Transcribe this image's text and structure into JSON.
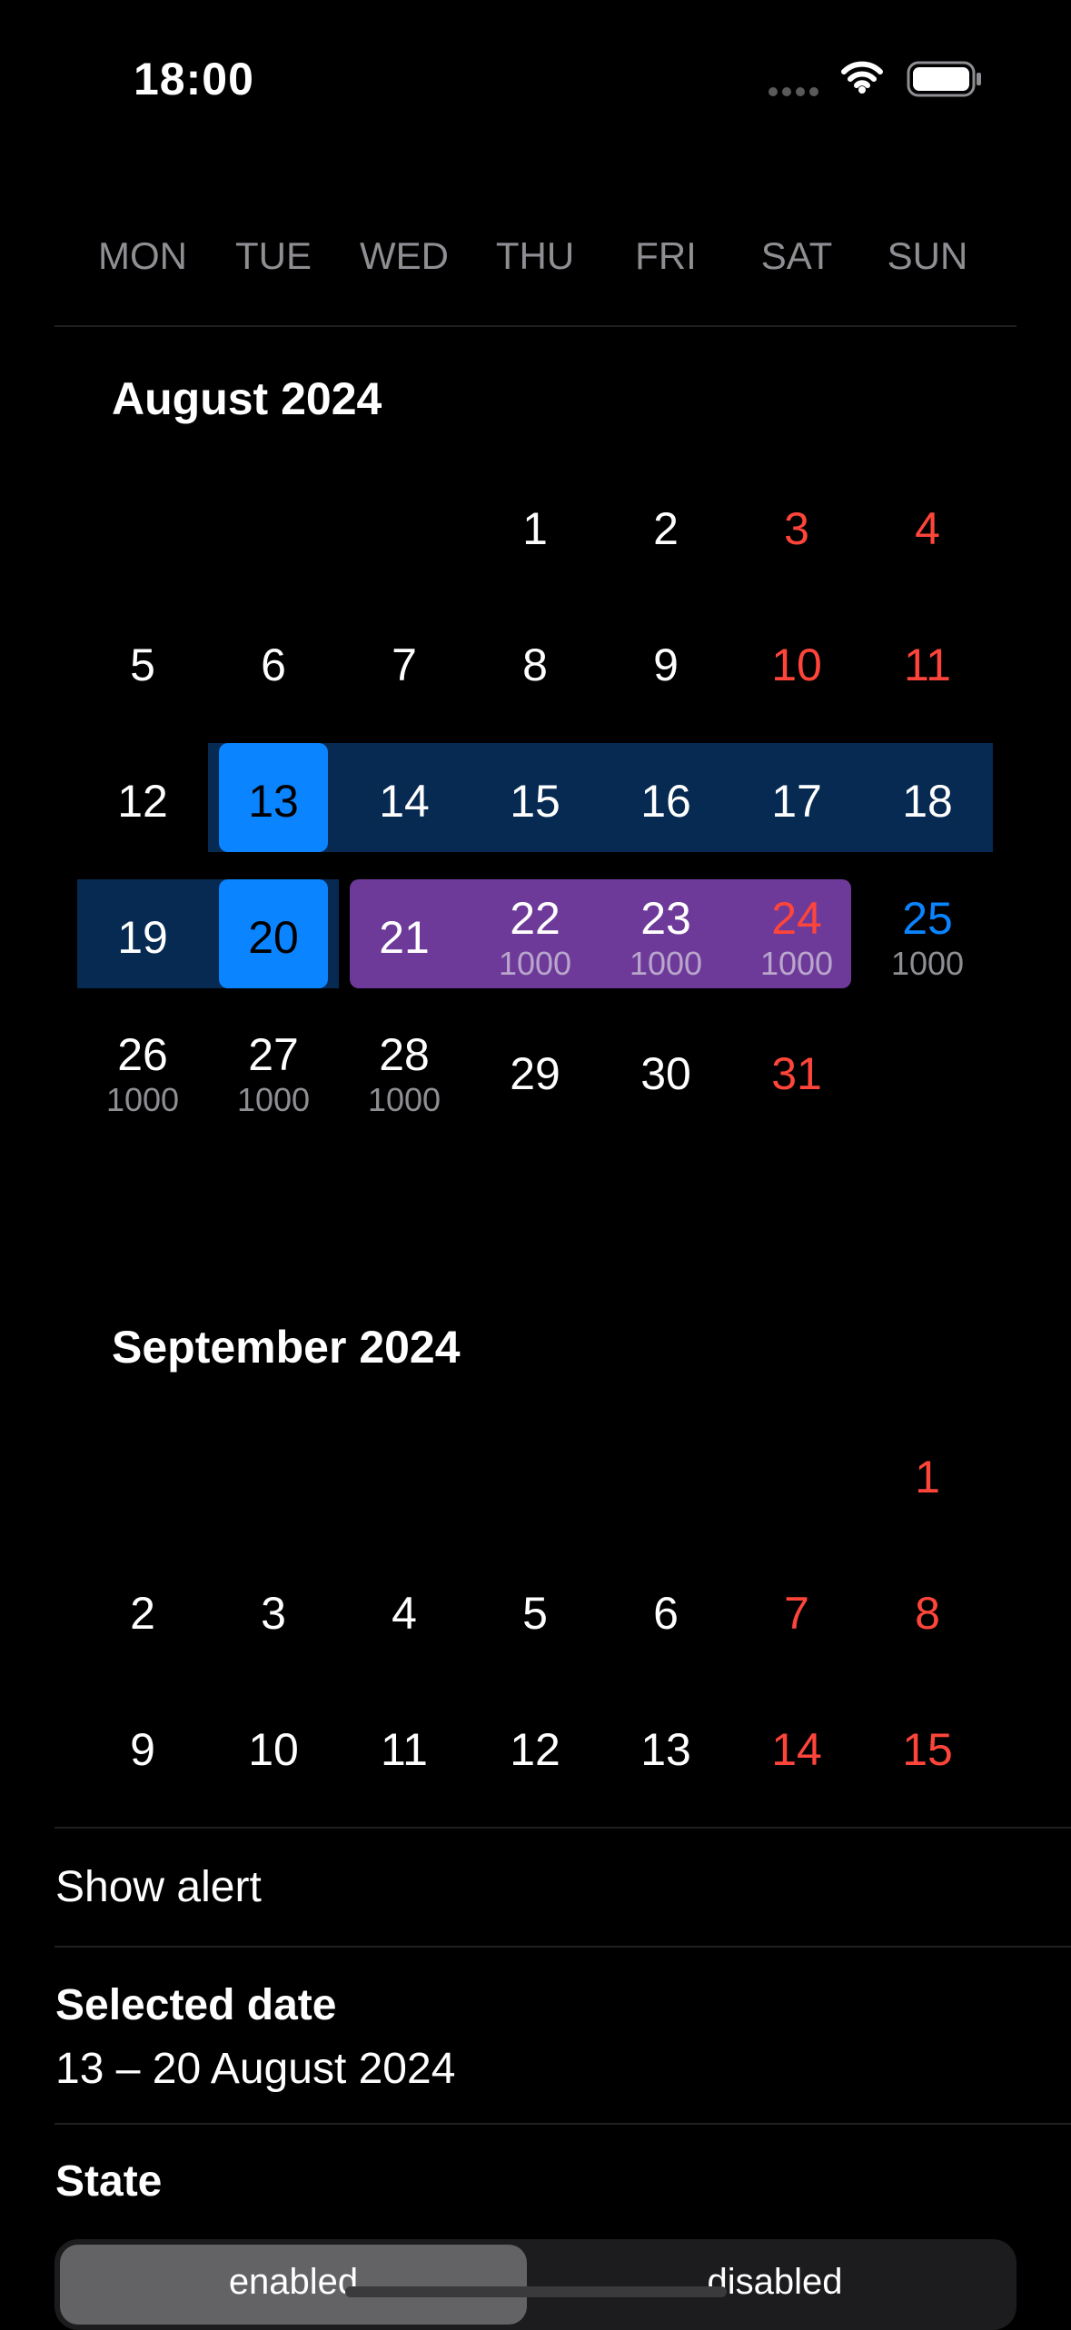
{
  "status_bar": {
    "time": "18:00"
  },
  "weekdays": [
    "MON",
    "TUE",
    "WED",
    "THU",
    "FRI",
    "SAT",
    "SUN"
  ],
  "months": [
    {
      "title": "August 2024",
      "weeks": [
        [
          null,
          null,
          null,
          {
            "d": "1"
          },
          {
            "d": "2"
          },
          {
            "d": "3",
            "red": true
          },
          {
            "d": "4",
            "red": true
          }
        ],
        [
          {
            "d": "5"
          },
          {
            "d": "6"
          },
          {
            "d": "7"
          },
          {
            "d": "8"
          },
          {
            "d": "9"
          },
          {
            "d": "10",
            "red": true
          },
          {
            "d": "11",
            "red": true
          }
        ],
        [
          {
            "d": "12"
          },
          {
            "d": "13",
            "sel": "edge"
          },
          {
            "d": "14",
            "sel": "range"
          },
          {
            "d": "15",
            "sel": "range"
          },
          {
            "d": "16",
            "sel": "range"
          },
          {
            "d": "17",
            "sel": "range"
          },
          {
            "d": "18",
            "sel": "range"
          }
        ],
        [
          {
            "d": "19",
            "sel": "range"
          },
          {
            "d": "20",
            "sel": "edge"
          },
          {
            "d": "21",
            "hl": true
          },
          {
            "d": "22",
            "sub": "1000",
            "hl": true
          },
          {
            "d": "23",
            "sub": "1000",
            "hl": true
          },
          {
            "d": "24",
            "sub": "1000",
            "hl": true,
            "red": true
          },
          {
            "d": "25",
            "sub": "1000",
            "blue": true
          }
        ],
        [
          {
            "d": "26",
            "sub": "1000"
          },
          {
            "d": "27",
            "sub": "1000"
          },
          {
            "d": "28",
            "sub": "1000"
          },
          {
            "d": "29"
          },
          {
            "d": "30"
          },
          {
            "d": "31",
            "red": true
          },
          null
        ]
      ]
    },
    {
      "title": "September 2024",
      "weeks": [
        [
          null,
          null,
          null,
          null,
          null,
          null,
          {
            "d": "1",
            "red": true
          }
        ],
        [
          {
            "d": "2"
          },
          {
            "d": "3"
          },
          {
            "d": "4"
          },
          {
            "d": "5"
          },
          {
            "d": "6"
          },
          {
            "d": "7",
            "red": true
          },
          {
            "d": "8",
            "red": true
          }
        ],
        [
          {
            "d": "9"
          },
          {
            "d": "10"
          },
          {
            "d": "11"
          },
          {
            "d": "12"
          },
          {
            "d": "13"
          },
          {
            "d": "14",
            "red": true
          },
          {
            "d": "15",
            "red": true
          }
        ]
      ]
    }
  ],
  "list": {
    "show_alert": "Show alert",
    "selected_date_label": "Selected date",
    "selected_date_value": "13 – 20 August 2024",
    "state_label": "State"
  },
  "segmented": {
    "options": [
      "enabled",
      "disabled"
    ],
    "selected": "enabled"
  },
  "colors": {
    "background": "#000000",
    "weekend_red": "#ff453a",
    "accent_blue": "#0a84ff",
    "range_blue": "#062a52",
    "highlight_purple": "#6e3a99",
    "secondary_gray": "#8e8e93"
  },
  "icons": [
    "signal-icon",
    "wifi-icon",
    "battery-icon"
  ]
}
